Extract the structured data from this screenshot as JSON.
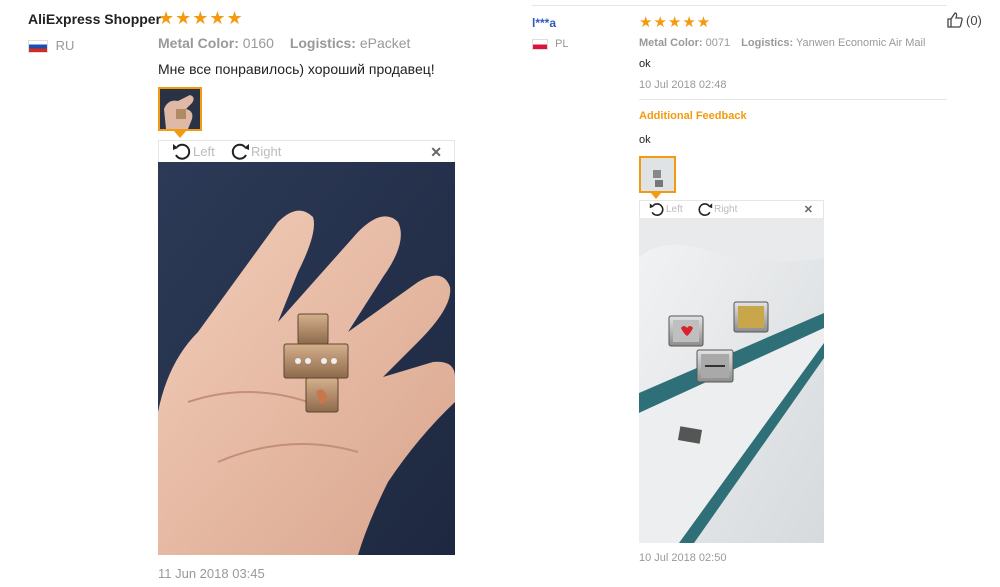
{
  "reviews": [
    {
      "author": "AliExpress Shopper",
      "country": "RU",
      "stars": "★★★★★",
      "props": [
        {
          "label": "Metal Color:",
          "value": "0160"
        },
        {
          "label": "Logistics:",
          "value": "ePacket"
        }
      ],
      "text": "Мне все понравилось) хороший продавец!",
      "viewer": {
        "rotate_left": "Left",
        "rotate_right": "Right",
        "close": "✕"
      },
      "date": "11 Jun 2018 03:45"
    },
    {
      "author": "l***a",
      "country": "PL",
      "stars": "★★★★★",
      "props": [
        {
          "label": "Metal Color:",
          "value": "0071"
        },
        {
          "label": "Logistics:",
          "value": "Yanwen Economic Air Mail"
        }
      ],
      "text": "ok",
      "date": "10 Jul 2018 02:48",
      "helpful": "(0)",
      "additional": {
        "title": "Additional Feedback",
        "text": "ok",
        "viewer": {
          "rotate_left": "Left",
          "rotate_right": "Right",
          "close": "✕"
        },
        "date": "10 Jul 2018 02:50"
      }
    }
  ],
  "colors": {
    "accent": "#f29b11",
    "link": "#2e5cb8"
  }
}
